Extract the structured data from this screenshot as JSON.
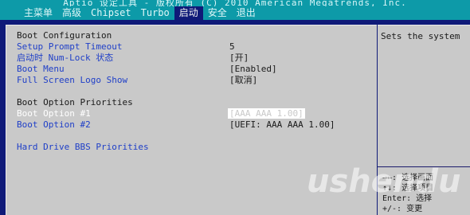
{
  "title_bar": "Aptio 设定工具 - 版权所有 (C) 2010 American Megatrends, Inc.",
  "tabs": [
    "主菜单",
    "高级",
    "Chipset",
    "Turbo",
    "启动",
    "安全",
    "退出"
  ],
  "active_tab": "启动",
  "main": {
    "section_header": "Boot Configuration",
    "setup_prompt_timeout": {
      "label": "Setup Prompt Timeout",
      "value": "5"
    },
    "numlock": {
      "label": "启动时 Num-Lock 状态",
      "value": "[开]"
    },
    "boot_menu": {
      "label": "Boot Menu",
      "value": "[Enabled]"
    },
    "full_screen_logo": {
      "label": "Full Screen Logo Show",
      "value": "[取消]"
    },
    "priorities_header": "Boot Option Priorities",
    "boot_option_1": {
      "label": "Boot Option #1",
      "value": "[AAA AAA 1.00]"
    },
    "boot_option_2": {
      "label": "Boot Option #2",
      "value": "[UEFI: AAA AAA 1.00]"
    },
    "hdd_bbs": "Hard Drive BBS Priorities"
  },
  "help": {
    "text": "Sets the system",
    "keys": [
      "→←: 选择画面",
      "↑↓: 选择项目",
      "Enter: 选择",
      "+/-: 变更"
    ]
  },
  "watermark": "ushendu",
  "colors": {
    "bg": "#0f1a78",
    "bar": "#0d9aa8",
    "panel": "#c9c9c9",
    "link": "#1f3fc8"
  }
}
